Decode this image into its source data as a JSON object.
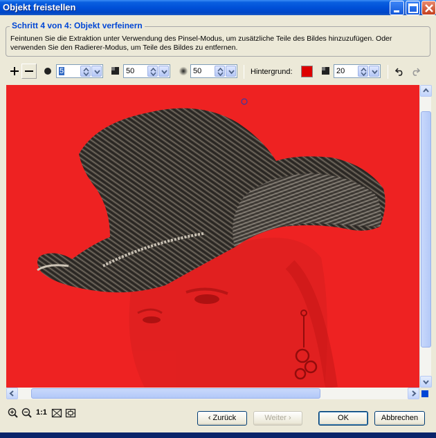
{
  "window": {
    "title": "Objekt freistellen"
  },
  "step": {
    "title": "Schritt 4 von 4: Objekt verfeinern",
    "instructions": "Feintunen Sie die Extraktion unter Verwendung des Pinsel-Modus, um zusätzliche Teile des Bildes hinzuzufügen. Oder verwenden Sie den Radierer-Modus, um Teile des Bildes zu entfernen."
  },
  "toolbar": {
    "brush_size": "5",
    "hardness": "50",
    "opacity": "50",
    "background_label": "Hintergrund:",
    "background_color": "#dd0000",
    "background_value": "20"
  },
  "zoom": {
    "actual_size_label": "1:1"
  },
  "buttons": {
    "back": "‹ Zurück",
    "next": "Weiter ›",
    "ok": "OK",
    "cancel": "Abbrechen"
  },
  "colors": {
    "overlay": "#ee2222",
    "title_bar": "#0050d8",
    "accent_text": "#0046d5"
  }
}
